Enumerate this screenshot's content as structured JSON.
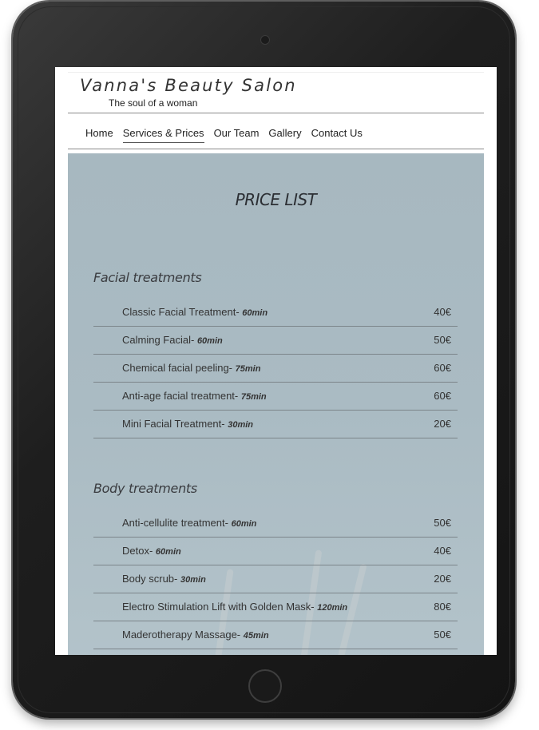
{
  "site": {
    "title": "Vanna's Beauty Salon",
    "tagline": "The soul of a woman"
  },
  "nav": {
    "items": [
      "Home",
      "Services & Prices",
      "Our Team",
      "Gallery",
      "Contact Us"
    ],
    "active": "Services & Prices"
  },
  "price_list": {
    "title": "PRICE LIST",
    "sections": [
      {
        "title": "Facial treatments",
        "items": [
          {
            "name": "Classic Facial Treatment-",
            "duration": "60min",
            "price": "40€"
          },
          {
            "name": "Calming Facial-",
            "duration": "60min",
            "price": "50€"
          },
          {
            "name": "Chemical facial peeling-",
            "duration": "75min",
            "price": "60€"
          },
          {
            "name": "Anti-age facial treatment-",
            "duration": "75min",
            "price": "60€"
          },
          {
            "name": "Mini Facial Treatment-",
            "duration": "30min",
            "price": "20€"
          }
        ]
      },
      {
        "title": "Body treatments",
        "items": [
          {
            "name": "Anti-cellulite treatment-",
            "duration": "60min",
            "price": "50€"
          },
          {
            "name": "Detox-",
            "duration": "60min",
            "price": "40€"
          },
          {
            "name": "Body scrub-",
            "duration": "30min",
            "price": "20€"
          },
          {
            "name": "Electro Stimulation Lift with Golden Mask-",
            "duration": "120min",
            "price": "80€"
          },
          {
            "name": "Maderotherapy Massage-",
            "duration": "45min",
            "price": "50€"
          }
        ]
      }
    ]
  },
  "icons": {
    "camera": "front-camera-icon",
    "home_button": "home-button-icon"
  },
  "colors": {
    "content_background": "#aabbc3",
    "text": "#333333",
    "divider": "#7c858a",
    "device_frame": "#1e1e1e"
  }
}
